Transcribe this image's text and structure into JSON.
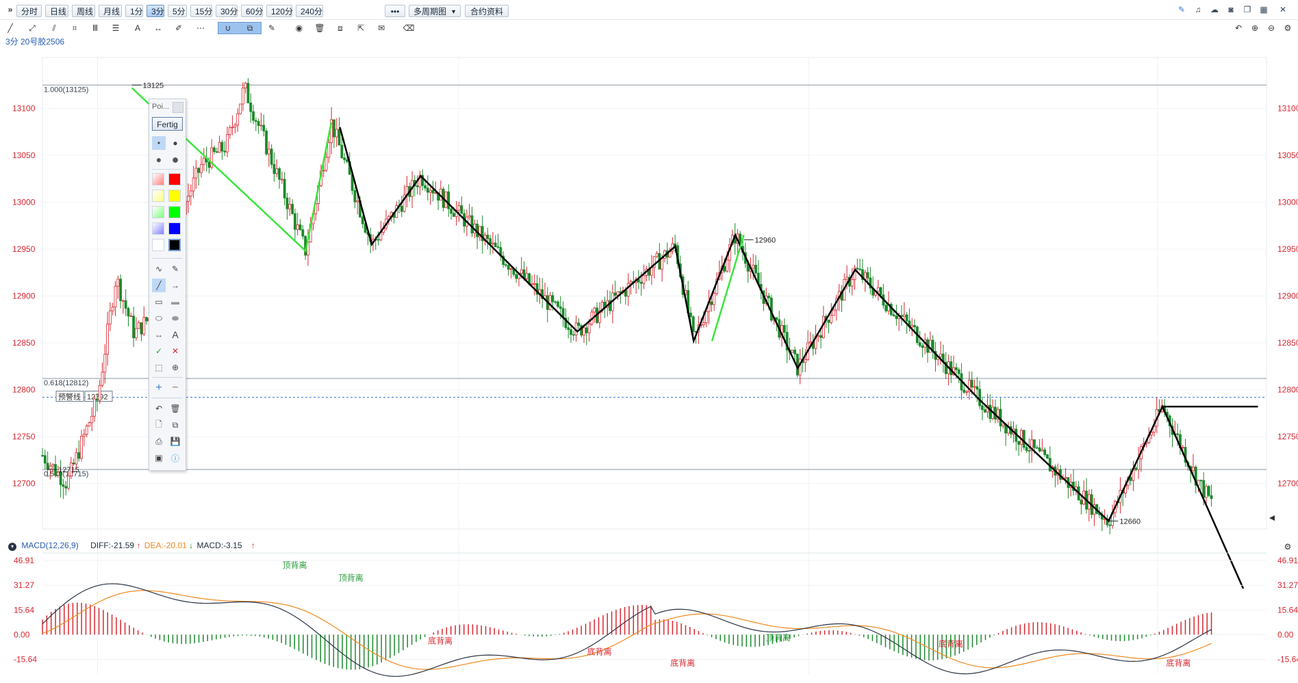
{
  "toolbar": {
    "expand_icon": "double-chevron-right-icon",
    "periods": [
      "分时",
      "日线",
      "周线",
      "月线",
      "1分",
      "3分",
      "5分",
      "15分",
      "30分",
      "60分",
      "120分",
      "240分"
    ],
    "active_period": "3分",
    "more_label": "•••",
    "multi_period_label": "多周期图",
    "contract_info_label": "合约资料",
    "right_icons": [
      "pen-icon",
      "bell-icon",
      "cloud-icon",
      "camera-icon",
      "window-icon",
      "grid-icon",
      "close-icon"
    ]
  },
  "drawing_tools": [
    "line-icon",
    "ray-icon",
    "channel-icon",
    "crop-icon",
    "bars-icon",
    "align-icon",
    "text-icon",
    "measure-icon",
    "brush-icon",
    "more-icon",
    "magnet-icon",
    "copy-icon",
    "pen-edit-icon",
    "eye-icon",
    "delete-icon",
    "layers-icon",
    "export-icon",
    "comment-icon",
    "eraser-icon"
  ],
  "contract_label": "3分 20号胶2506",
  "chart_controls": [
    "undo-icon",
    "zoom-in-icon",
    "zoom-out-icon",
    "settings-icon"
  ],
  "palette": {
    "title": "Poi...",
    "done_label": "Fertig",
    "colors": [
      "#ff8080",
      "#ff0000",
      "#ffff80",
      "#ffff00",
      "#80ff80",
      "#00ff00",
      "#8080ff",
      "#0000ff",
      "#ffffff",
      "#000000"
    ]
  },
  "chart_data": {
    "type": "candlestick",
    "price_ticks": [
      13100,
      13050,
      13000,
      12950,
      12900,
      12850,
      12800,
      12750,
      12700
    ],
    "ylim": [
      12650,
      13150
    ],
    "fib_levels": [
      {
        "label": "1.000(13125)",
        "value": 13125
      },
      {
        "label": "0.618(12812)",
        "value": 12812
      },
      {
        "label": "0.500(12715)",
        "value": 12715
      }
    ],
    "annotations": [
      {
        "text": "13125",
        "value": 13125
      },
      {
        "text": "12960",
        "value": 12960
      },
      {
        "text": "12715",
        "value": 12715
      },
      {
        "text": "12660",
        "value": 12660
      }
    ],
    "alert_label": "预警线",
    "alert_price": "12792",
    "zigzag_black": [
      {
        "t": 0.243,
        "v": 13080
      },
      {
        "t": 0.269,
        "v": 12955
      },
      {
        "t": 0.309,
        "v": 13028
      },
      {
        "t": 0.437,
        "v": 12862
      },
      {
        "t": 0.517,
        "v": 12953
      },
      {
        "t": 0.532,
        "v": 12852
      },
      {
        "t": 0.566,
        "v": 12965
      },
      {
        "t": 0.617,
        "v": 12823
      },
      {
        "t": 0.664,
        "v": 12928
      },
      {
        "t": 0.765,
        "v": 12790
      },
      {
        "t": 0.871,
        "v": 12660
      },
      {
        "t": 0.915,
        "v": 12782
      },
      {
        "t": 0.981,
        "v": 12588
      }
    ],
    "zigzag_green": [
      {
        "t": 0.073,
        "v": 13122
      },
      {
        "t": 0.215,
        "v": 12948
      },
      {
        "t": 0.236,
        "v": 13085
      }
    ],
    "zigzag_green2": [
      {
        "t": 0.547,
        "v": 12852
      },
      {
        "t": 0.573,
        "v": 12965
      }
    ],
    "hline_black": {
      "t0": 0.915,
      "t1": 0.993,
      "v": 12782
    },
    "macd": {
      "header_label": "MACD(12,26,9)",
      "diff": "DIFF:-21.59",
      "dea": "DEA:-20.01",
      "macd": "MACD:-3.15",
      "ticks": [
        "46.91",
        "31.27",
        "15.64",
        "0.00",
        "-15.64"
      ],
      "tick_values": [
        46.91,
        31.27,
        15.64,
        0.0,
        -15.64
      ],
      "ylim": [
        -25,
        50
      ],
      "divergence_labels": [
        {
          "text": "顶背离",
          "t": 0.196,
          "v": 44,
          "color": "#2a9d3a"
        },
        {
          "text": "顶背离",
          "t": 0.242,
          "v": 36,
          "color": "#2a9d3a"
        },
        {
          "text": "底背离",
          "t": 0.315,
          "v": -4,
          "color": "#d9262f"
        },
        {
          "text": "底背离",
          "t": 0.445,
          "v": -11,
          "color": "#d9262f"
        },
        {
          "text": "底背离",
          "t": 0.513,
          "v": -18,
          "color": "#d9262f"
        },
        {
          "text": "顶背离",
          "t": 0.591,
          "v": -2,
          "color": "#2a9d3a"
        },
        {
          "text": "底背离",
          "t": 0.732,
          "v": -6,
          "color": "#d9262f"
        },
        {
          "text": "底背离",
          "t": 0.918,
          "v": -18,
          "color": "#d9262f"
        }
      ]
    },
    "colors": {
      "up": "#d9262f",
      "down": "#1b8a2b",
      "diff": "#2a3444",
      "dea": "#f0881c",
      "fib": "#8a94a0",
      "alert": "#3d78d6"
    }
  }
}
